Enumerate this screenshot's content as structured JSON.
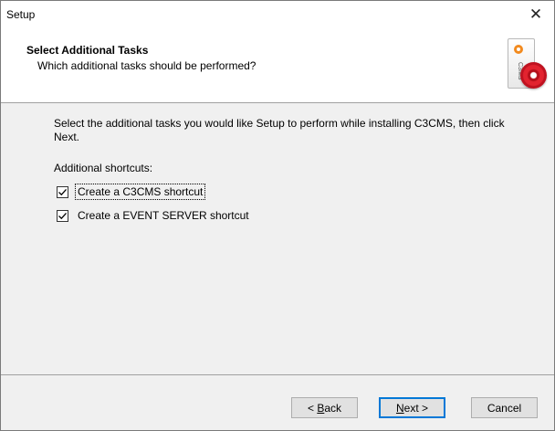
{
  "window": {
    "title": "Setup",
    "close_glyph": "✕",
    "close_icon": "close-icon"
  },
  "header": {
    "title": "Select Additional Tasks",
    "subtitle": "Which additional tasks should be performed?",
    "logo_text": "C3MS",
    "logo_icon": "c3cms-setup-logo-icon"
  },
  "content": {
    "intro": "Select the additional tasks you would like Setup to perform while installing C3CMS, then click Next.",
    "group_label": "Additional shortcuts:",
    "tasks": [
      {
        "label": "Create a C3CMS shortcut",
        "checked": true,
        "focused": true
      },
      {
        "label": "Create a EVENT SERVER shortcut",
        "checked": true,
        "focused": false
      }
    ]
  },
  "buttons": {
    "back": {
      "prefix": "< ",
      "accel": "B",
      "rest": "ack"
    },
    "next": {
      "accel": "N",
      "rest": "ext >"
    },
    "cancel": {
      "label": "Cancel"
    }
  },
  "colors": {
    "accent": "#0078d7",
    "panel": "#f0f0f0",
    "header": "#ffffff"
  }
}
